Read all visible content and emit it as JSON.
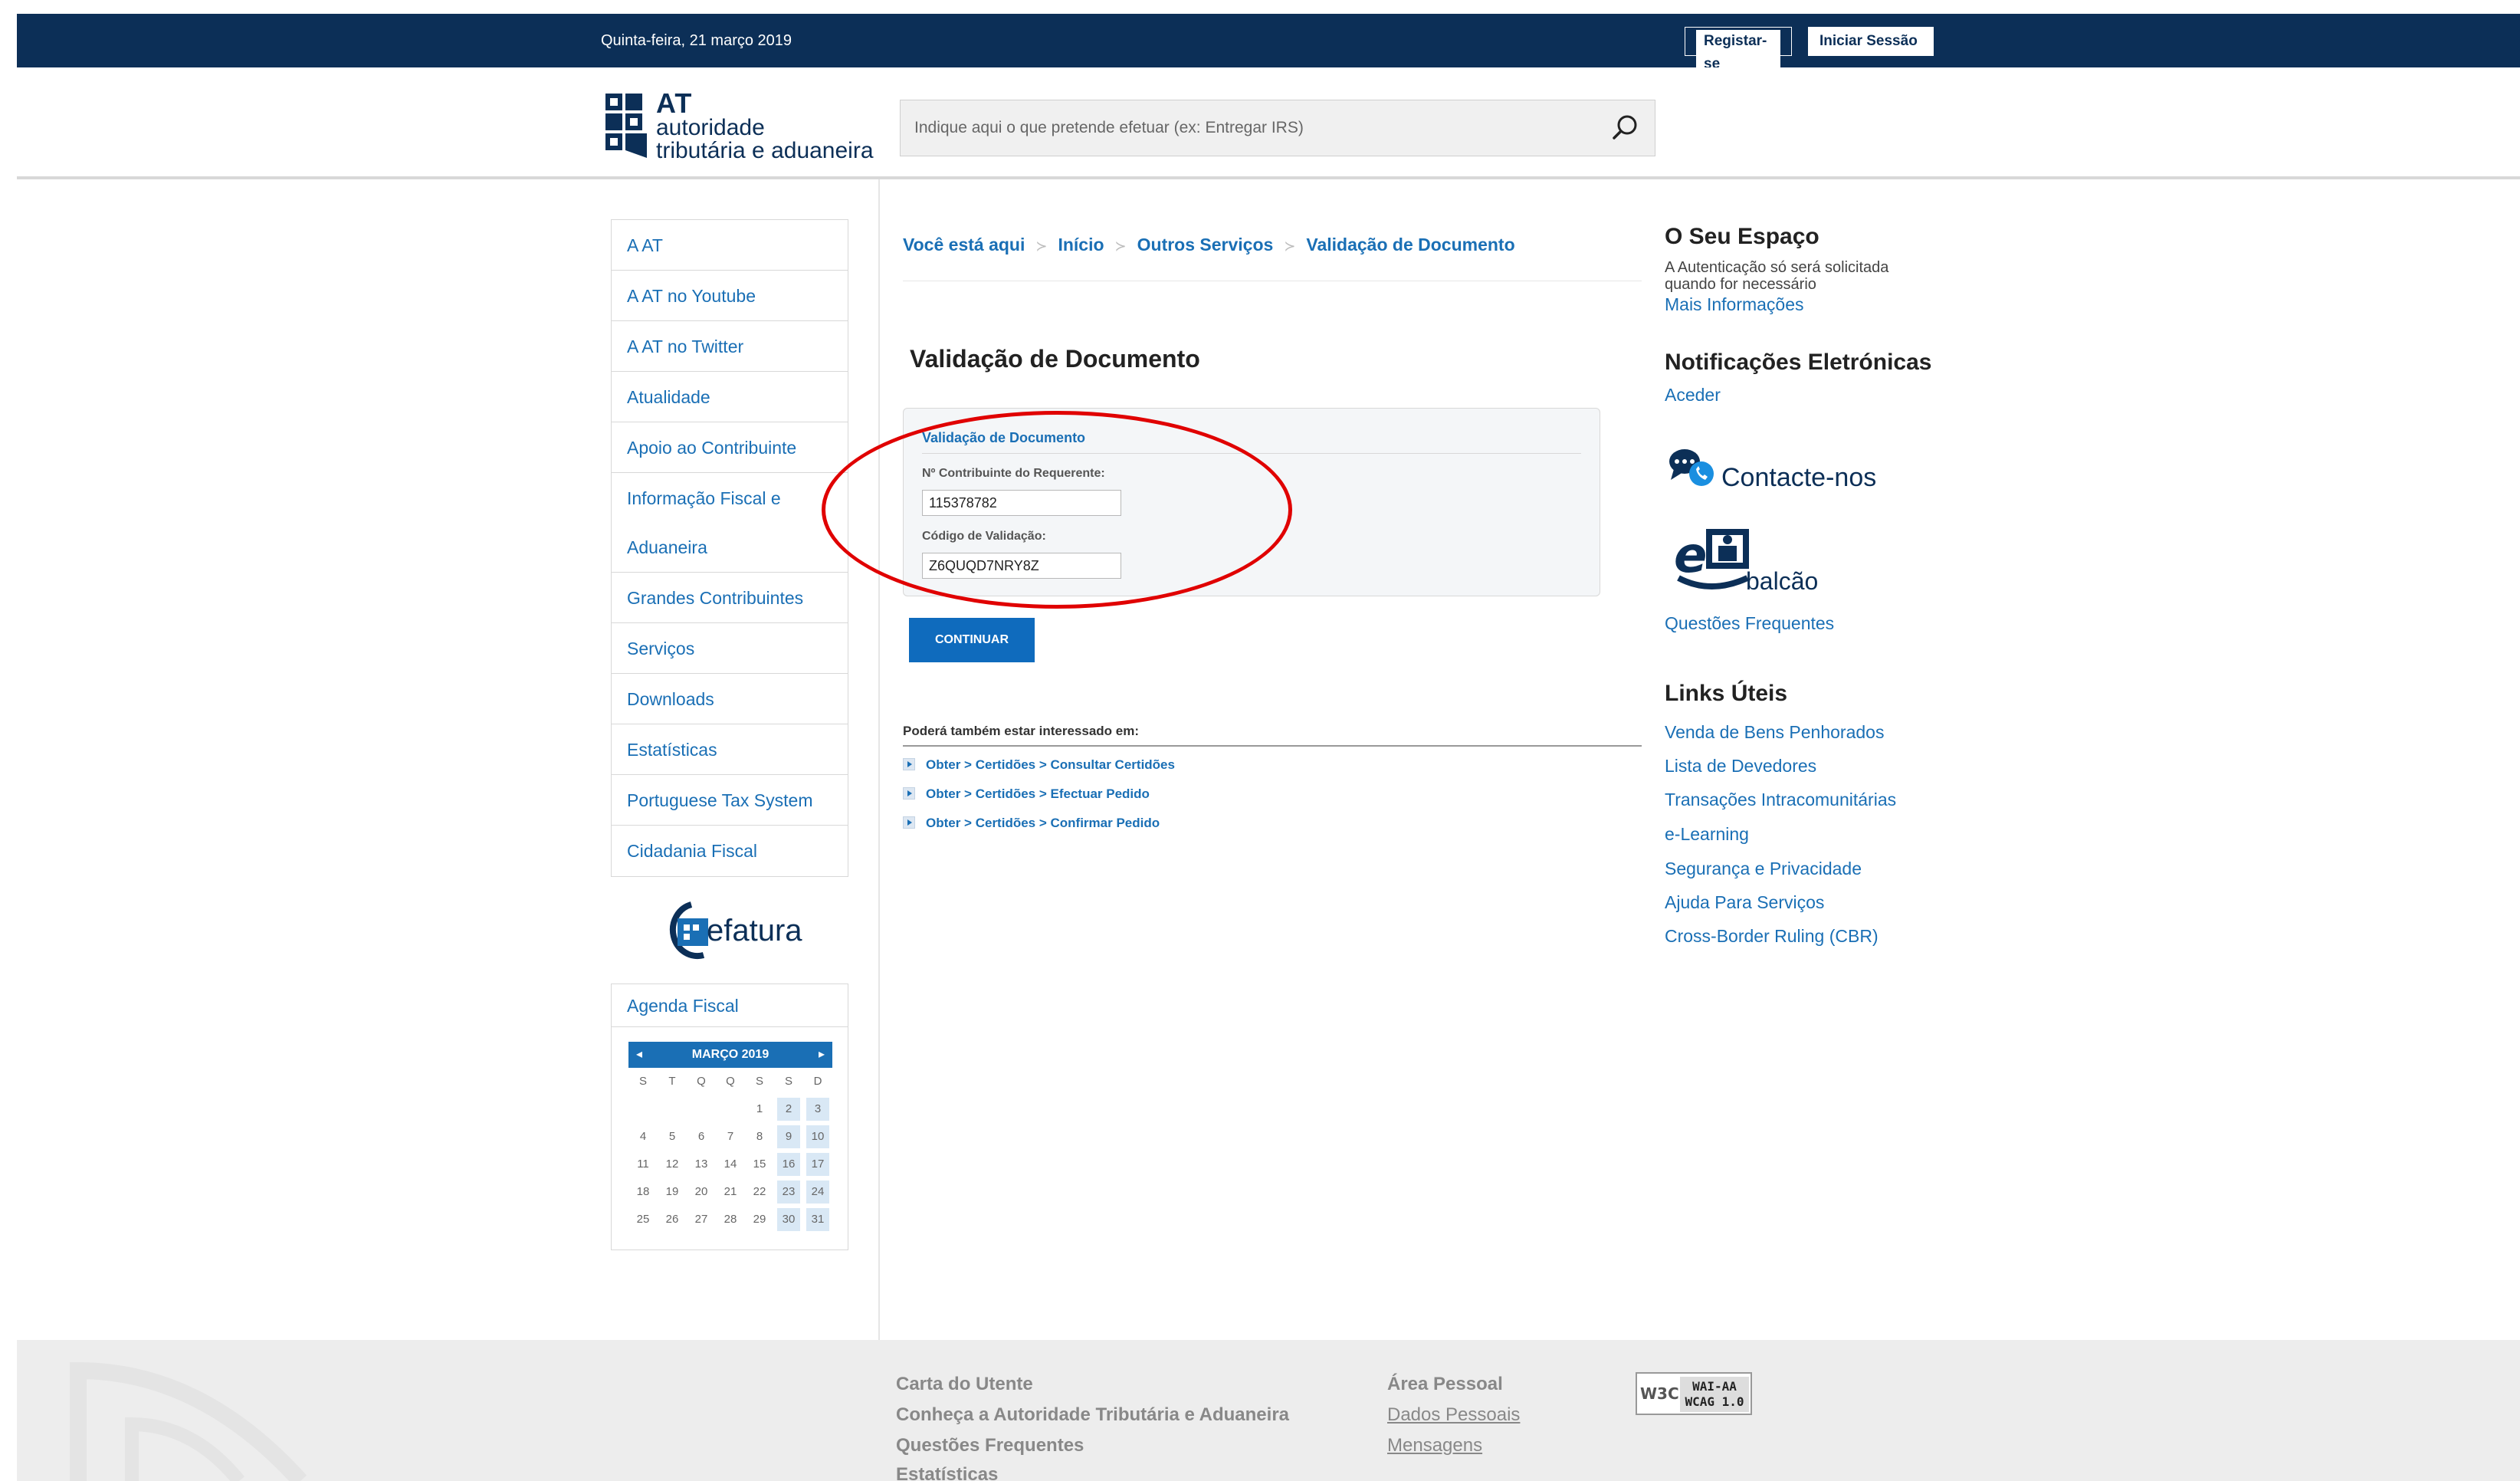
{
  "topbar": {
    "date": "Quinta-feira, 21 março 2019",
    "register_label": "Registar-se",
    "login_label": "Iniciar Sessão"
  },
  "logo": {
    "line1": "AT",
    "line2": "autoridade",
    "line3": "tributária e aduaneira"
  },
  "search": {
    "placeholder": "Indique aqui o que pretende efetuar (ex: Entregar IRS)"
  },
  "leftnav": {
    "items": [
      "A AT",
      "A AT no Youtube",
      "A AT no Twitter",
      "Atualidade",
      "Apoio ao Contribuinte",
      "Informação Fiscal e",
      "Aduaneira",
      "Grandes Contribuintes",
      "Serviços",
      "Downloads",
      "Estatísticas",
      "Portuguese Tax System",
      "Cidadania Fiscal"
    ]
  },
  "efatura": {
    "label": "efatura"
  },
  "agenda": {
    "title": "Agenda Fiscal",
    "month": "MARÇO 2019",
    "weekdays": [
      "S",
      "T",
      "Q",
      "Q",
      "S",
      "S",
      "D"
    ],
    "weeks": [
      [
        "",
        "",
        "",
        "",
        "1",
        "2",
        "3"
      ],
      [
        "4",
        "5",
        "6",
        "7",
        "8",
        "9",
        "10"
      ],
      [
        "11",
        "12",
        "13",
        "14",
        "15",
        "16",
        "17"
      ],
      [
        "18",
        "19",
        "20",
        "21",
        "22",
        "23",
        "24"
      ],
      [
        "25",
        "26",
        "27",
        "28",
        "29",
        "30",
        "31"
      ]
    ]
  },
  "breadcrumb": {
    "you_are_here": "Você está aqui",
    "home": "Início",
    "other": "Outros Serviços",
    "current": "Validação de Documento"
  },
  "main": {
    "title": "Validação de Documento",
    "form_title": "Validação de Documento",
    "nif_label": "Nº Contribuinte do Requerente:",
    "nif_value": "115378782",
    "code_label": "Código de Validação:",
    "code_value": "Z6QUQD7NRY8Z",
    "continue_label": "CONTINUAR",
    "interest_title": "Poderá também estar interessado em:",
    "interest_links": [
      "Obter > Certidões > Consultar Certidões",
      "Obter > Certidões > Efectuar Pedido",
      "Obter > Certidões > Confirmar Pedido"
    ]
  },
  "right": {
    "space_title": "O Seu Espaço",
    "space_text1": "A Autenticação só será solicitada",
    "space_text2": "quando for necessário",
    "space_more": "Mais Informações",
    "notif_title": "Notificações Eletrónicas",
    "notif_link": "Aceder",
    "contact_label": "Contacte-nos",
    "balcao_label": "balcão",
    "faq_link": "Questões Frequentes",
    "links_title": "Links Úteis",
    "links": [
      "Venda de Bens Penhorados",
      "Lista de Devedores",
      "Transações Intracomunitárias",
      "e-Learning",
      "Segurança e Privacidade",
      "Ajuda Para Serviços",
      "Cross-Border Ruling (CBR)"
    ]
  },
  "footer": {
    "col1": [
      "Carta do Utente",
      "Conheça a Autoridade Tributária e Aduaneira",
      "Questões Frequentes",
      "Estatísticas"
    ],
    "col2_title": "Área Pessoal",
    "col2": [
      "Dados Pessoais",
      "Mensagens"
    ],
    "w3c_a": "W3C",
    "w3c_b1": "WAI-AA",
    "w3c_b2": "WCAG 1.0"
  }
}
